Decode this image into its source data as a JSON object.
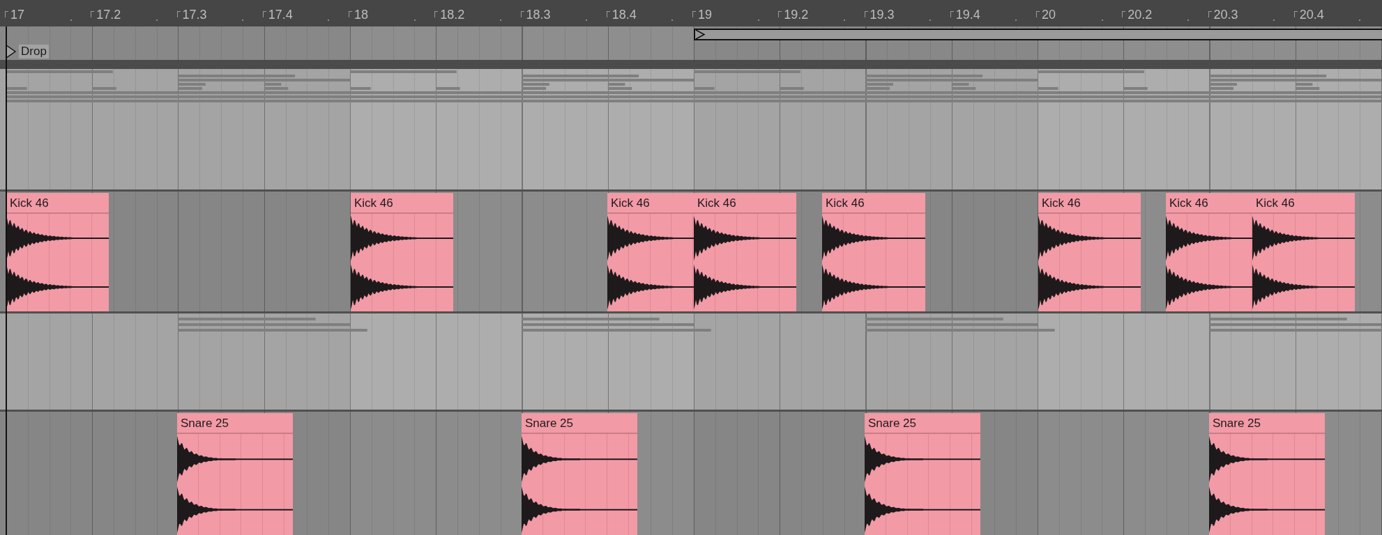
{
  "ruler": {
    "labels": [
      "17",
      "17.2",
      "17.3",
      "17.4",
      "18",
      "18.2",
      "18.3",
      "18.4",
      "19",
      "19.2",
      "19.3",
      "19.4",
      "20",
      "20.2",
      "20.3",
      "20.4"
    ]
  },
  "locators": [
    {
      "name": "Drop"
    }
  ],
  "tracks": [
    {
      "kind": "midi"
    },
    {
      "kind": "audio",
      "clips": [
        {
          "name": "Kick 46"
        },
        {
          "name": "Kick 46"
        },
        {
          "name": "Kick 46"
        },
        {
          "name": "Kick 46"
        },
        {
          "name": "Kick 46"
        },
        {
          "name": "Kick 46"
        },
        {
          "name": "Kick 46"
        },
        {
          "name": "Kick 46"
        }
      ]
    },
    {
      "kind": "midi"
    },
    {
      "kind": "audio",
      "clips": [
        {
          "name": "Snare 25"
        },
        {
          "name": "Snare 25"
        },
        {
          "name": "Snare 25"
        },
        {
          "name": "Snare 25"
        }
      ]
    }
  ]
}
